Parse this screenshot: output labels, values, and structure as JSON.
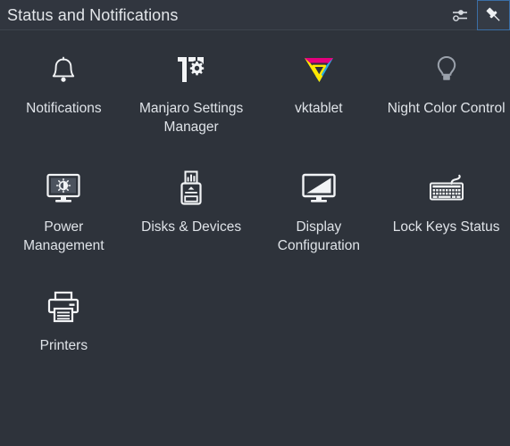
{
  "window": {
    "title": "Status and Notifications"
  },
  "header": {
    "actions": [
      {
        "name": "configure-icon",
        "label": "Configure",
        "icon": "sliders-icon",
        "active": false
      },
      {
        "name": "pin-icon",
        "label": "Keep Open",
        "icon": "pin-icon",
        "active": true
      }
    ]
  },
  "colors": {
    "background": "#2e333b",
    "titlebar": "#31363f",
    "divider": "#3d434d",
    "text": "#dfe3e8",
    "title_text": "#e3e6ea",
    "icon": "#f2f4f6",
    "icon_dim": "#9aa1ab",
    "accent": "#3b6ea5",
    "vktablet_magenta": "#e5007e",
    "vktablet_cyan": "#29abe2",
    "vktablet_yellow": "#ffe800"
  },
  "grid": {
    "columns": 4,
    "items": [
      {
        "label": "Notifications",
        "icon": "bell-icon"
      },
      {
        "label": "Manjaro Settings Manager",
        "icon": "manjaro-settings-icon"
      },
      {
        "label": "vktablet",
        "icon": "vktablet-icon"
      },
      {
        "label": "Night Color Control",
        "icon": "lightbulb-icon"
      },
      {
        "label": "Power Management",
        "icon": "monitor-brightness-icon"
      },
      {
        "label": "Disks & Devices",
        "icon": "usb-drive-icon"
      },
      {
        "label": "Display Configuration",
        "icon": "monitor-icon"
      },
      {
        "label": "Lock Keys Status",
        "icon": "keyboard-icon"
      },
      {
        "label": "Printers",
        "icon": "printer-icon"
      }
    ]
  }
}
